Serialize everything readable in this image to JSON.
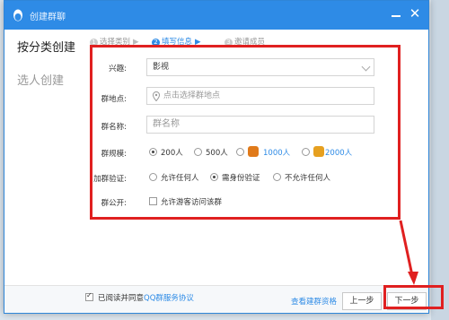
{
  "window": {
    "title": "创建群聊"
  },
  "leftnav": {
    "by_category": "按分类创建",
    "select_people": "选人创建"
  },
  "steps": [
    {
      "num": "1",
      "label": "选择类别"
    },
    {
      "num": "2",
      "label": "填写信息"
    },
    {
      "num": "3",
      "label": "邀请成员"
    }
  ],
  "form": {
    "interest": {
      "label": "兴趣:",
      "value": "影视"
    },
    "location": {
      "label": "群地点:",
      "placeholder": "点击选择群地点"
    },
    "name": {
      "label": "群名称:",
      "placeholder": "群名称"
    },
    "size": {
      "label": "群规模:",
      "options": [
        "200人",
        "500人",
        "1000人",
        "2000人"
      ],
      "selected": "200人"
    },
    "verify": {
      "label": "加群验证:",
      "options": [
        "允许任何人",
        "需身份验证",
        "不允许任何人"
      ],
      "selected": "需身份验证"
    },
    "public": {
      "label": "群公开:",
      "checkbox_label": "允许游客访问该群"
    }
  },
  "footer": {
    "agree_prefix": "已阅读并同意",
    "agree_link": "QQ群服务协议",
    "qual_link": "查看建群资格",
    "prev_label": "上一步",
    "next_label": "下一步"
  },
  "colors": {
    "accent": "#2e8be6",
    "highlight": "#e02020"
  }
}
